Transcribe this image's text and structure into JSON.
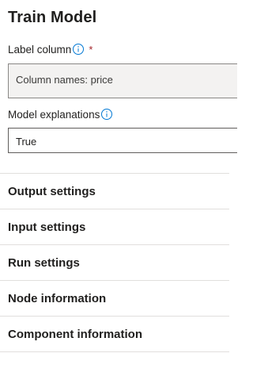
{
  "panel": {
    "title": "Train Model"
  },
  "label_column": {
    "label": "Label column",
    "required_marker": "*",
    "value": "Column names: price"
  },
  "model_explanations": {
    "label": "Model explanations",
    "value": "True"
  },
  "sections": [
    {
      "label": "Output settings"
    },
    {
      "label": "Input settings"
    },
    {
      "label": "Run settings"
    },
    {
      "label": "Node information"
    },
    {
      "label": "Component information"
    }
  ],
  "colors": {
    "info_icon": "#0078d4",
    "required": "#a4262c",
    "divider": "#e1dfdd",
    "field_bg": "#f3f2f1"
  },
  "icons": {
    "info": "info-icon"
  }
}
